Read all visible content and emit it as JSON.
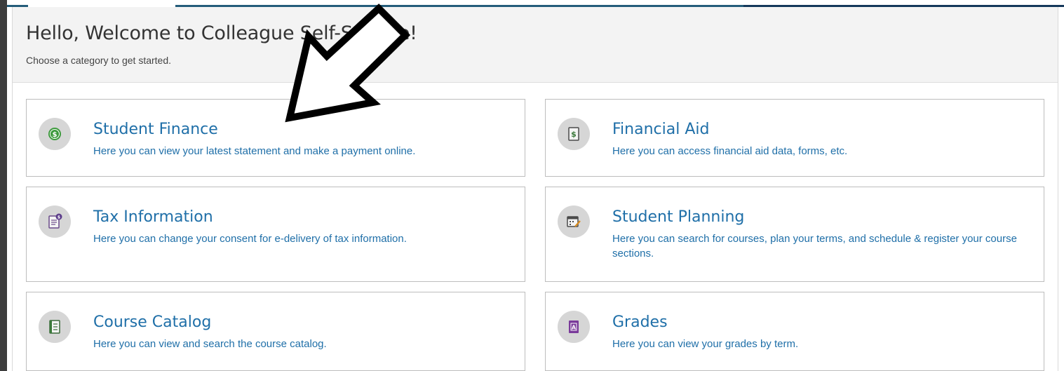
{
  "header": {
    "title": "Hello, Welcome to Colleague Self-Service!",
    "subtitle": "Choose a category to get started."
  },
  "cards": [
    {
      "title": "Student Finance",
      "description": "Here you can view your latest statement and make a payment online.",
      "icon": "dollar-coin-icon"
    },
    {
      "title": "Financial Aid",
      "description": "Here you can access financial aid data, forms, etc.",
      "icon": "money-document-icon"
    },
    {
      "title": "Tax Information",
      "description": "Here you can change your consent for e-delivery of tax information.",
      "icon": "tax-document-icon"
    },
    {
      "title": "Student Planning",
      "description": "Here you can search for courses, plan your terms, and schedule & register your course sections.",
      "icon": "calendar-edit-icon"
    },
    {
      "title": "Course Catalog",
      "description": "Here you can view and search the course catalog.",
      "icon": "catalog-book-icon"
    },
    {
      "title": "Grades",
      "description": "Here you can view your grades by term.",
      "icon": "grade-report-icon"
    }
  ],
  "colors": {
    "link": "#1f6fa8",
    "icon_bg": "#d6d6d6",
    "header_bg": "#f3f3f3"
  }
}
